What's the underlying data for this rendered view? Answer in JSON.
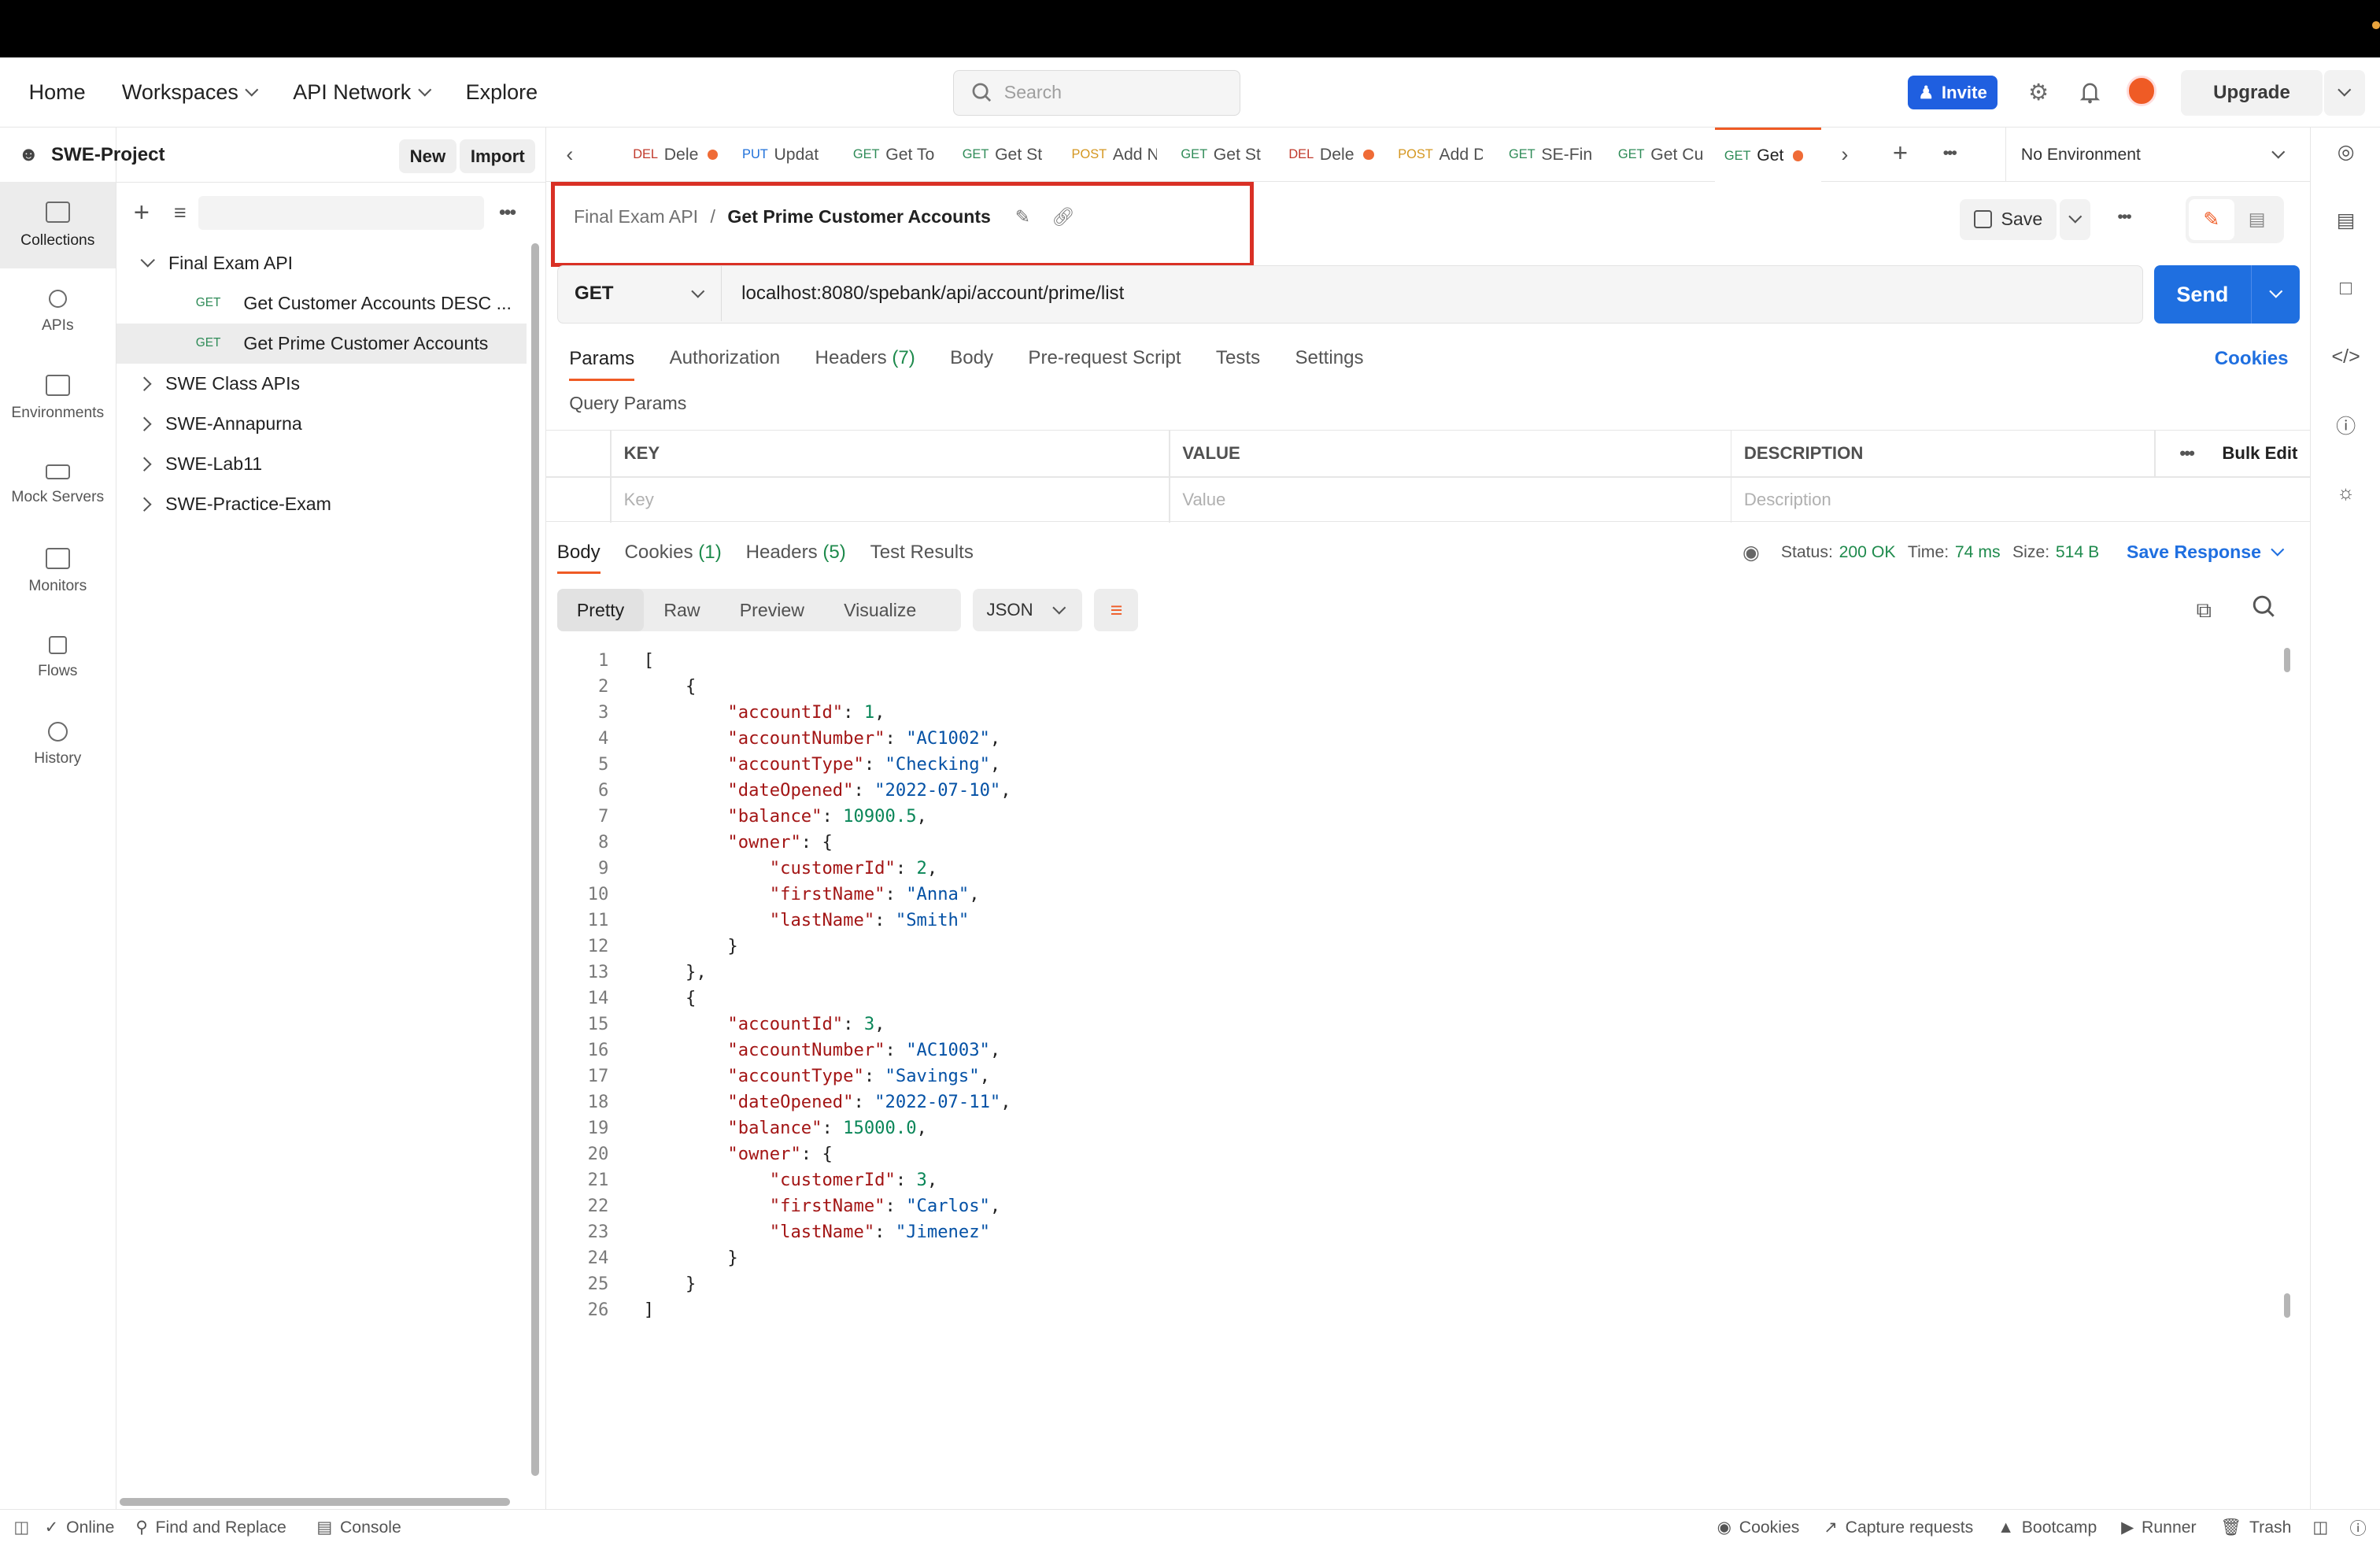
{
  "header": {
    "nav": [
      "Home",
      "Workspaces",
      "API Network",
      "Explore"
    ],
    "search_placeholder": "Search",
    "invite_label": "Invite",
    "upgrade_label": "Upgrade"
  },
  "leftnav": [
    "Collections",
    "APIs",
    "Environments",
    "Mock Servers",
    "Monitors",
    "Flows",
    "History"
  ],
  "sidebar": {
    "workspace": "SWE-Project",
    "new_label": "New",
    "import_label": "Import",
    "tree": [
      {
        "label": "Final Exam API",
        "method": ""
      },
      {
        "label": "Get Customer Accounts DESC ...",
        "method": "GET"
      },
      {
        "label": "Get Prime Customer Accounts",
        "method": "GET"
      },
      {
        "label": "SWE Class APIs",
        "method": ""
      },
      {
        "label": "SWE-Annapurna",
        "method": ""
      },
      {
        "label": "SWE-Lab11",
        "method": ""
      },
      {
        "label": "SWE-Practice-Exam",
        "method": ""
      }
    ]
  },
  "tabs": [
    {
      "method": "DEL",
      "label": "Dele"
    },
    {
      "method": "PUT",
      "label": "Updat"
    },
    {
      "method": "GET",
      "label": "Get To"
    },
    {
      "method": "GET",
      "label": "Get St"
    },
    {
      "method": "POST",
      "label": "Add N"
    },
    {
      "method": "GET",
      "label": "Get St"
    },
    {
      "method": "DEL",
      "label": "Dele"
    },
    {
      "method": "POST",
      "label": "Add D"
    },
    {
      "method": "GET",
      "label": "SE-Fin"
    },
    {
      "method": "GET",
      "label": "Get Cu"
    },
    {
      "method": "GET",
      "label": "Get"
    }
  ],
  "environment": "No Environment",
  "request": {
    "breadcrumb_parent": "Final Exam API",
    "breadcrumb_sep": "/",
    "title": "Get Prime Customer Accounts",
    "save_label": "Save",
    "method": "GET",
    "url": "localhost:8080/spebank/api/account/prime/list",
    "send_label": "Send",
    "tabs": [
      "Params",
      "Authorization",
      "Headers",
      "Body",
      "Pre-request Script",
      "Tests",
      "Settings"
    ],
    "headers_count": "(7)",
    "cookies_label": "Cookies",
    "query_params_label": "Query Params",
    "table_headers": [
      "KEY",
      "VALUE",
      "DESCRIPTION"
    ],
    "bulk_edit": "Bulk Edit",
    "placeholders": [
      "Key",
      "Value",
      "Description"
    ]
  },
  "response": {
    "tabs": [
      "Body",
      "Cookies",
      "Headers",
      "Test Results"
    ],
    "cookies_count": "(1)",
    "headers_count": "(5)",
    "status_label": "Status:",
    "status_value": "200 OK",
    "time_label": "Time:",
    "time_value": "74 ms",
    "size_label": "Size:",
    "size_value": "514 B",
    "save_response": "Save Response",
    "view_modes": [
      "Pretty",
      "Raw",
      "Preview",
      "Visualize"
    ],
    "format": "JSON"
  },
  "code_lines": [
    "[",
    "    {",
    "        \"accountId\": 1,",
    "        \"accountNumber\": \"AC1002\",",
    "        \"accountType\": \"Checking\",",
    "        \"dateOpened\": \"2022-07-10\",",
    "        \"balance\": 10900.5,",
    "        \"owner\": {",
    "            \"customerId\": 2,",
    "            \"firstName\": \"Anna\",",
    "            \"lastName\": \"Smith\"",
    "        }",
    "    },",
    "    {",
    "        \"accountId\": 3,",
    "        \"accountNumber\": \"AC1003\",",
    "        \"accountType\": \"Savings\",",
    "        \"dateOpened\": \"2022-07-11\",",
    "        \"balance\": 15000.0,",
    "        \"owner\": {",
    "            \"customerId\": 3,",
    "            \"firstName\": \"Carlos\",",
    "            \"lastName\": \"Jimenez\"",
    "        }",
    "    }",
    "]"
  ],
  "footer": {
    "online": "Online",
    "find_replace": "Find and Replace",
    "console": "Console",
    "cookies": "Cookies",
    "capture": "Capture requests",
    "bootcamp": "Bootcamp",
    "runner": "Runner",
    "trash": "Trash"
  },
  "colors": {
    "accent": "#ef5b25",
    "send": "#1f6fe0",
    "invite": "#1f5fe0",
    "status_ok": "#1e8a4c",
    "highlight_box": "#d93025"
  }
}
